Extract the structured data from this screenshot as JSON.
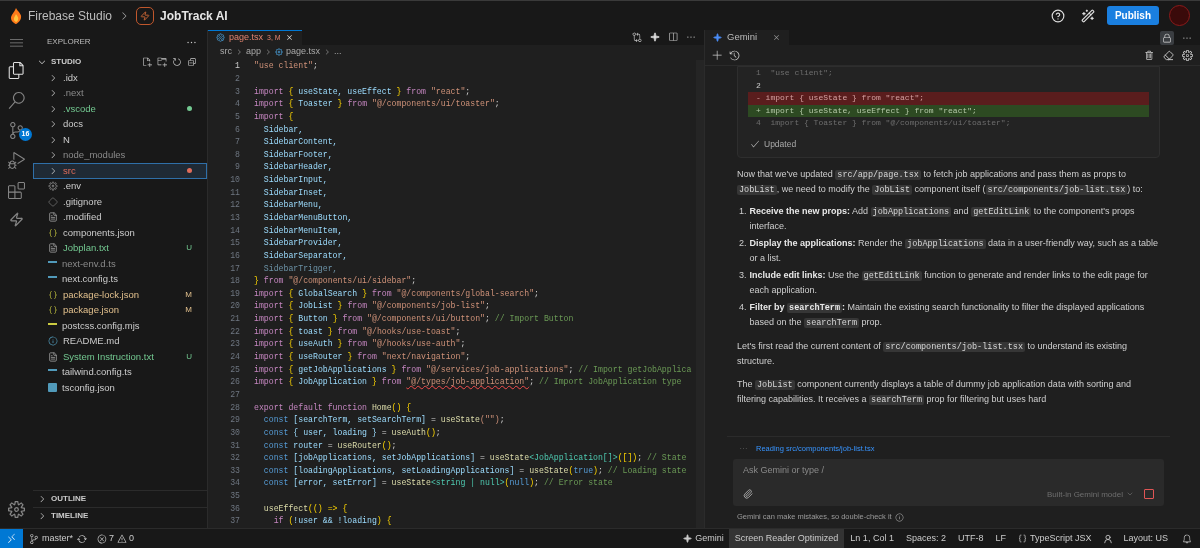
{
  "top_bar": {
    "app_name": "Firebase Studio",
    "project_name": "JobTrack AI",
    "publish_label": "Publish"
  },
  "activity_bar": {
    "source_control_badge": "16"
  },
  "explorer": {
    "title": "EXPLORER",
    "sections": [
      {
        "label": "STUDIO",
        "expanded": true,
        "children": [
          {
            "label": ".idx",
            "kind": "folder",
            "selected": false,
            "ignored": false,
            "untracked": false,
            "modified": false,
            "error": false,
            "dot": false
          },
          {
            "label": ".next",
            "kind": "folder",
            "selected": false,
            "ignored": true,
            "untracked": false,
            "modified": false,
            "error": false,
            "dot": false
          },
          {
            "label": ".vscode",
            "kind": "folder",
            "selected": false,
            "ignored": false,
            "untracked": true,
            "modified": false,
            "error": false,
            "dot": true
          },
          {
            "label": "docs",
            "kind": "folder",
            "selected": false,
            "ignored": false,
            "untracked": false,
            "modified": false,
            "error": false,
            "dot": false
          },
          {
            "label": "N",
            "kind": "folder",
            "selected": false,
            "ignored": false,
            "untracked": false,
            "modified": false,
            "error": false,
            "dot": false
          },
          {
            "label": "node_modules",
            "kind": "folder",
            "selected": false,
            "ignored": true,
            "untracked": false,
            "modified": false,
            "error": false,
            "dot": false
          },
          {
            "label": "src",
            "kind": "folder",
            "selected": true,
            "ignored": false,
            "untracked": false,
            "modified": false,
            "error": true,
            "dot": true
          },
          {
            "label": ".env",
            "kind": "gear",
            "selected": false,
            "ignored": false,
            "untracked": false,
            "modified": false,
            "error": false,
            "dot": false
          },
          {
            "label": ".gitignore",
            "kind": "diamond",
            "selected": false,
            "ignored": false,
            "untracked": false,
            "modified": false,
            "error": false,
            "dot": false
          },
          {
            "label": ".modified",
            "kind": "text",
            "selected": false,
            "ignored": false,
            "untracked": false,
            "modified": false,
            "error": false,
            "dot": false
          },
          {
            "label": "components.json",
            "kind": "json",
            "selected": false,
            "ignored": false,
            "untracked": false,
            "modified": false,
            "error": false,
            "dot": false
          },
          {
            "label": "Jobplan.txt",
            "kind": "text",
            "selected": false,
            "ignored": false,
            "untracked": true,
            "modified": false,
            "error": false,
            "dot": false,
            "status": "U"
          },
          {
            "label": "next-env.d.ts",
            "kind": "ts",
            "selected": false,
            "ignored": true,
            "untracked": false,
            "modified": false,
            "error": false,
            "dot": false
          },
          {
            "label": "next.config.ts",
            "kind": "ts",
            "selected": false,
            "ignored": false,
            "untracked": false,
            "modified": false,
            "error": false,
            "dot": false
          },
          {
            "label": "package-lock.json",
            "kind": "json",
            "selected": false,
            "ignored": false,
            "untracked": false,
            "modified": true,
            "error": false,
            "dot": false,
            "status": "M"
          },
          {
            "label": "package.json",
            "kind": "json",
            "selected": false,
            "ignored": false,
            "untracked": false,
            "modified": true,
            "error": false,
            "dot": false,
            "status": "M"
          },
          {
            "label": "postcss.config.mjs",
            "kind": "js",
            "selected": false,
            "ignored": false,
            "untracked": false,
            "modified": false,
            "error": false,
            "dot": false
          },
          {
            "label": "README.md",
            "kind": "info",
            "selected": false,
            "ignored": false,
            "untracked": false,
            "modified": false,
            "error": false,
            "dot": false
          },
          {
            "label": "System Instruction.txt",
            "kind": "text",
            "selected": false,
            "ignored": false,
            "untracked": true,
            "modified": false,
            "error": false,
            "dot": false,
            "status": "U"
          },
          {
            "label": "tailwind.config.ts",
            "kind": "ts",
            "selected": false,
            "ignored": false,
            "untracked": false,
            "modified": false,
            "error": false,
            "dot": false
          },
          {
            "label": "tsconfig.json",
            "kind": "tsconfig",
            "selected": false,
            "ignored": false,
            "untracked": false,
            "modified": false,
            "error": false,
            "dot": false
          }
        ]
      },
      {
        "label": "OUTLINE",
        "expanded": false
      },
      {
        "label": "TIMELINE",
        "expanded": false
      }
    ]
  },
  "editor": {
    "tab": {
      "label": "page.tsx",
      "badge": "3, M"
    },
    "breadcrumb": [
      "src",
      "app",
      "page.tsx",
      "..."
    ],
    "lines": [
      {
        "n": "1",
        "tokens": [
          {
            "kind": "str",
            "text": "\"use client\""
          },
          {
            "kind": "punct",
            "text": ";"
          }
        ]
      },
      {
        "n": "2"
      },
      {
        "n": "3",
        "tokens": [
          {
            "kind": "kw",
            "text": "import "
          },
          {
            "kind": "brace",
            "text": "{"
          },
          {
            "kind": "id",
            "text": " useState, useEffect "
          },
          {
            "kind": "brace",
            "text": "}"
          },
          {
            "kind": "kw",
            "text": " from "
          },
          {
            "kind": "str",
            "text": "\"react\""
          },
          {
            "kind": "punct",
            "text": ";"
          }
        ]
      },
      {
        "n": "4",
        "tokens": [
          {
            "kind": "kw",
            "text": "import "
          },
          {
            "kind": "brace",
            "text": "{"
          },
          {
            "kind": "id",
            "text": " Toaster "
          },
          {
            "kind": "brace",
            "text": "}"
          },
          {
            "kind": "kw",
            "text": " from "
          },
          {
            "kind": "str",
            "text": "\"@/components/ui/toaster\""
          },
          {
            "kind": "punct",
            "text": ";"
          }
        ]
      },
      {
        "n": "5",
        "tokens": [
          {
            "kind": "kw",
            "text": "import "
          },
          {
            "kind": "brace",
            "text": "{"
          }
        ]
      },
      {
        "n": "6",
        "tokens": [
          {
            "kind": "id",
            "text": "  Sidebar,"
          }
        ]
      },
      {
        "n": "7",
        "tokens": [
          {
            "kind": "id",
            "text": "  SidebarContent,"
          }
        ]
      },
      {
        "n": "8",
        "tokens": [
          {
            "kind": "id",
            "text": "  SidebarFooter,"
          }
        ]
      },
      {
        "n": "9",
        "tokens": [
          {
            "kind": "id",
            "text": "  SidebarHeader,"
          }
        ]
      },
      {
        "n": "10",
        "tokens": [
          {
            "kind": "id",
            "text": "  SidebarInput,"
          }
        ]
      },
      {
        "n": "11",
        "tokens": [
          {
            "kind": "id",
            "text": "  SidebarInset,"
          }
        ]
      },
      {
        "n": "12",
        "tokens": [
          {
            "kind": "id",
            "text": "  SidebarMenu,"
          }
        ]
      },
      {
        "n": "13",
        "tokens": [
          {
            "kind": "id",
            "text": "  SidebarMenuButton,"
          }
        ]
      },
      {
        "n": "14",
        "tokens": [
          {
            "kind": "id",
            "text": "  SidebarMenuItem,"
          }
        ]
      },
      {
        "n": "15",
        "tokens": [
          {
            "kind": "id",
            "text": "  SidebarProvider,"
          }
        ]
      },
      {
        "n": "16",
        "tokens": [
          {
            "kind": "id",
            "text": "  SidebarSeparator,"
          }
        ]
      },
      {
        "n": "17",
        "tokens": [
          {
            "kind": "dim",
            "text": "  SidebarTrigger,"
          }
        ]
      },
      {
        "n": "18",
        "tokens": [
          {
            "kind": "brace",
            "text": "}"
          },
          {
            "kind": "kw",
            "text": " from "
          },
          {
            "kind": "str",
            "text": "\"@/components/ui/sidebar\""
          },
          {
            "kind": "punct",
            "text": ";"
          }
        ]
      },
      {
        "n": "19",
        "tokens": [
          {
            "kind": "kw",
            "text": "import "
          },
          {
            "kind": "brace",
            "text": "{"
          },
          {
            "kind": "id",
            "text": " GlobalSearch "
          },
          {
            "kind": "brace",
            "text": "}"
          },
          {
            "kind": "kw",
            "text": " from "
          },
          {
            "kind": "str",
            "text": "\"@/components/global-search\""
          },
          {
            "kind": "punct",
            "text": ";"
          }
        ]
      },
      {
        "n": "20",
        "tokens": [
          {
            "kind": "kw",
            "text": "import "
          },
          {
            "kind": "brace",
            "text": "{"
          },
          {
            "kind": "id",
            "text": " JobList "
          },
          {
            "kind": "brace",
            "text": "}"
          },
          {
            "kind": "kw",
            "text": " from "
          },
          {
            "kind": "str",
            "text": "\"@/components/job-list\""
          },
          {
            "kind": "punct",
            "text": ";"
          }
        ]
      },
      {
        "n": "21",
        "tokens": [
          {
            "kind": "kw",
            "text": "import "
          },
          {
            "kind": "brace",
            "text": "{"
          },
          {
            "kind": "id",
            "text": " Button "
          },
          {
            "kind": "brace",
            "text": "}"
          },
          {
            "kind": "kw",
            "text": " from "
          },
          {
            "kind": "str",
            "text": "\"@/components/ui/button\""
          },
          {
            "kind": "punct",
            "text": "; "
          },
          {
            "kind": "comment",
            "text": "// Import Button"
          }
        ]
      },
      {
        "n": "22",
        "tokens": [
          {
            "kind": "kw",
            "text": "import "
          },
          {
            "kind": "brace",
            "text": "{"
          },
          {
            "kind": "id",
            "text": " toast "
          },
          {
            "kind": "brace",
            "text": "}"
          },
          {
            "kind": "kw",
            "text": " from "
          },
          {
            "kind": "str",
            "text": "\"@/hooks/use-toast\""
          },
          {
            "kind": "punct",
            "text": ";"
          }
        ]
      },
      {
        "n": "23",
        "tokens": [
          {
            "kind": "kw",
            "text": "import "
          },
          {
            "kind": "brace",
            "text": "{"
          },
          {
            "kind": "id",
            "text": " useAuth "
          },
          {
            "kind": "brace",
            "text": "}"
          },
          {
            "kind": "kw",
            "text": " from "
          },
          {
            "kind": "str",
            "text": "\"@/hooks/use-auth\""
          },
          {
            "kind": "punct",
            "text": ";"
          }
        ]
      },
      {
        "n": "24",
        "tokens": [
          {
            "kind": "kw",
            "text": "import "
          },
          {
            "kind": "brace",
            "text": "{"
          },
          {
            "kind": "id",
            "text": " useRouter "
          },
          {
            "kind": "brace",
            "text": "}"
          },
          {
            "kind": "kw",
            "text": " from "
          },
          {
            "kind": "str",
            "text": "\"next/navigation\""
          },
          {
            "kind": "punct",
            "text": ";"
          }
        ]
      },
      {
        "n": "25",
        "tokens": [
          {
            "kind": "kw",
            "text": "import "
          },
          {
            "kind": "brace",
            "text": "{"
          },
          {
            "kind": "id",
            "text": " getJobApplications "
          },
          {
            "kind": "brace",
            "text": "}"
          },
          {
            "kind": "kw",
            "text": " from "
          },
          {
            "kind": "str",
            "text": "\"@/services/job-applications\""
          },
          {
            "kind": "punct",
            "text": "; "
          },
          {
            "kind": "comment",
            "text": "// Import getJobApplica"
          }
        ]
      },
      {
        "n": "26",
        "tokens": [
          {
            "kind": "kw",
            "text": "import "
          },
          {
            "kind": "brace",
            "text": "{"
          },
          {
            "kind": "id",
            "text": " JobApplication "
          },
          {
            "kind": "brace",
            "text": "}"
          },
          {
            "kind": "kw",
            "text": " from "
          },
          {
            "kind": "err",
            "text": "\"@/types/job-application\""
          },
          {
            "kind": "punct",
            "text": "; "
          },
          {
            "kind": "comment",
            "text": "// Import JobApplication type"
          }
        ]
      },
      {
        "n": "27"
      },
      {
        "n": "28",
        "tokens": [
          {
            "kind": "kw",
            "text": "export default function "
          },
          {
            "kind": "fn",
            "text": "Home"
          },
          {
            "kind": "brace",
            "text": "() {"
          }
        ]
      },
      {
        "n": "29",
        "tokens": [
          {
            "kind": "decl",
            "text": "  const "
          },
          {
            "kind": "id",
            "text": "[searchTerm, setSearchTerm] "
          },
          {
            "kind": "punct",
            "text": "= "
          },
          {
            "kind": "fn",
            "text": "useState"
          },
          {
            "kind": "str",
            "text": "(\"\")"
          },
          {
            "kind": "punct",
            "text": ";"
          }
        ]
      },
      {
        "n": "30",
        "tokens": [
          {
            "kind": "decl",
            "text": "  const "
          },
          {
            "kind": "id",
            "text": "{ user, loading } "
          },
          {
            "kind": "punct",
            "text": "= "
          },
          {
            "kind": "fn",
            "text": "useAuth"
          },
          {
            "kind": "brace",
            "text": "()"
          },
          {
            "kind": "punct",
            "text": ";"
          }
        ]
      },
      {
        "n": "31",
        "tokens": [
          {
            "kind": "decl",
            "text": "  const "
          },
          {
            "kind": "id",
            "text": "router "
          },
          {
            "kind": "punct",
            "text": "= "
          },
          {
            "kind": "fn",
            "text": "useRouter"
          },
          {
            "kind": "brace",
            "text": "()"
          },
          {
            "kind": "punct",
            "text": ";"
          }
        ]
      },
      {
        "n": "32",
        "tokens": [
          {
            "kind": "decl",
            "text": "  const "
          },
          {
            "kind": "id",
            "text": "[jobApplications, setJobApplications] "
          },
          {
            "kind": "punct",
            "text": "= "
          },
          {
            "kind": "fn",
            "text": "useState"
          },
          {
            "kind": "type",
            "text": "<JobApplication[]>"
          },
          {
            "kind": "brace",
            "text": "([])"
          },
          {
            "kind": "punct",
            "text": "; "
          },
          {
            "kind": "comment",
            "text": "// State"
          }
        ]
      },
      {
        "n": "33",
        "tokens": [
          {
            "kind": "decl",
            "text": "  const "
          },
          {
            "kind": "id",
            "text": "[loadingApplications, setLoadingApplications] "
          },
          {
            "kind": "punct",
            "text": "= "
          },
          {
            "kind": "fn",
            "text": "useState"
          },
          {
            "kind": "brace",
            "text": "("
          },
          {
            "kind": "decl",
            "text": "true"
          },
          {
            "kind": "brace",
            "text": ")"
          },
          {
            "kind": "punct",
            "text": "; "
          },
          {
            "kind": "comment",
            "text": "// Loading state"
          }
        ]
      },
      {
        "n": "34",
        "tokens": [
          {
            "kind": "decl",
            "text": "  const "
          },
          {
            "kind": "id",
            "text": "[error, setError] "
          },
          {
            "kind": "punct",
            "text": "= "
          },
          {
            "kind": "fn",
            "text": "useState"
          },
          {
            "kind": "type",
            "text": "<string | null>"
          },
          {
            "kind": "brace",
            "text": "("
          },
          {
            "kind": "decl",
            "text": "null"
          },
          {
            "kind": "brace",
            "text": ")"
          },
          {
            "kind": "punct",
            "text": "; "
          },
          {
            "kind": "comment",
            "text": "// Error state"
          }
        ]
      },
      {
        "n": "35"
      },
      {
        "n": "36",
        "tokens": [
          {
            "kind": "fn",
            "text": "  useEffect"
          },
          {
            "kind": "brace",
            "text": "(() => {"
          }
        ]
      },
      {
        "n": "37",
        "tokens": [
          {
            "kind": "kw",
            "text": "    if "
          },
          {
            "kind": "brace",
            "text": "("
          },
          {
            "kind": "id",
            "text": "!user && !loading"
          },
          {
            "kind": "brace",
            "text": ") {"
          }
        ]
      }
    ]
  },
  "gemini": {
    "tab_label": "Gemini",
    "diff": {
      "lines": [
        {
          "kind": "faded",
          "text": "1  \"use client\";"
        },
        {
          "kind": "context",
          "text": "2"
        },
        {
          "kind": "removed",
          "text": "- import { useState } from \"react\";"
        },
        {
          "kind": "added",
          "text": "+ import { useState, useEffect } from \"react\";"
        },
        {
          "kind": "faded",
          "text": "4  import { Toaster } from \"@/components/ui/toaster\";"
        }
      ],
      "status": "Updated"
    },
    "blocks": [
      {
        "kind": "paragraph",
        "segments": [
          {
            "kind": "text",
            "text": "Now that we've updated "
          },
          {
            "kind": "code",
            "text": "src/app/page.tsx"
          },
          {
            "kind": "text",
            "text": " to fetch job applications and pass them as props to "
          },
          {
            "kind": "code",
            "text": "JobList"
          },
          {
            "kind": "text",
            "text": ", we need to modify the "
          },
          {
            "kind": "code",
            "text": "JobList"
          },
          {
            "kind": "text",
            "text": " component itself ("
          },
          {
            "kind": "code",
            "text": "src/components/job-list.tsx"
          },
          {
            "kind": "text",
            "text": ") to:"
          }
        ]
      },
      {
        "kind": "list",
        "items": [
          {
            "number": "1.",
            "segments": [
              {
                "kind": "bold",
                "text": "Receive the new props:"
              },
              {
                "kind": "text",
                "text": " Add "
              },
              {
                "kind": "code",
                "text": "jobApplications"
              },
              {
                "kind": "text",
                "text": " and "
              },
              {
                "kind": "code",
                "text": "getEditLink"
              },
              {
                "kind": "text",
                "text": " to the component's props interface."
              }
            ]
          },
          {
            "number": "2.",
            "segments": [
              {
                "kind": "bold",
                "text": "Display the applications:"
              },
              {
                "kind": "text",
                "text": " Render the "
              },
              {
                "kind": "code",
                "text": "jobApplications"
              },
              {
                "kind": "text",
                "text": " data in a user-friendly way, such as a table or a list."
              }
            ]
          },
          {
            "number": "3.",
            "segments": [
              {
                "kind": "bold",
                "text": "Include edit links:"
              },
              {
                "kind": "text",
                "text": " Use the "
              },
              {
                "kind": "code",
                "text": "getEditLink"
              },
              {
                "kind": "text",
                "text": " function to generate and render links to the edit page for each application."
              }
            ]
          },
          {
            "number": "4.",
            "segments": [
              {
                "kind": "bold",
                "text": "Filter by "
              },
              {
                "kind": "boldcode",
                "text": "searchTerm"
              },
              {
                "kind": "bold",
                "text": ":"
              },
              {
                "kind": "text",
                "text": " Maintain the existing search functionality to filter the displayed applications based on the "
              },
              {
                "kind": "code",
                "text": "searchTerm"
              },
              {
                "kind": "text",
                "text": " prop."
              }
            ]
          }
        ]
      },
      {
        "kind": "paragraph",
        "segments": [
          {
            "kind": "text",
            "text": "Let's first read the current content of "
          },
          {
            "kind": "code",
            "text": "src/components/job-list.tsx"
          },
          {
            "kind": "text",
            "text": " to understand its existing structure."
          }
        ]
      },
      {
        "kind": "paragraph",
        "segments": [
          {
            "kind": "text",
            "text": "The "
          },
          {
            "kind": "code",
            "text": "JobList"
          },
          {
            "kind": "text",
            "text": " component currently displays a table of dummy job application data with sorting and filtering capabilities. It receives a "
          },
          {
            "kind": "code",
            "text": "searchTerm"
          },
          {
            "kind": "text",
            "text": " prop for filtering but uses hard"
          }
        ]
      }
    ],
    "activity": "Reading src/components/job-list.tsx",
    "composer": {
      "placeholder": "Ask Gemini or type /",
      "model": "Built-in Gemini model"
    },
    "disclaimer": "Gemini can make mistakes, so double-check it"
  },
  "status_bar": {
    "branch": "master*",
    "errors": "7",
    "warnings": "0",
    "right": [
      {
        "kind": "gemini",
        "text": "Gemini"
      },
      {
        "kind": "highlight",
        "text": "Screen Reader Optimized"
      },
      {
        "kind": "plain",
        "text": "Ln 1, Col 1"
      },
      {
        "kind": "plain",
        "text": "Spaces: 2"
      },
      {
        "kind": "plain",
        "text": "UTF-8"
      },
      {
        "kind": "plain",
        "text": "LF"
      },
      {
        "kind": "braces",
        "text": "TypeScript JSX"
      },
      {
        "kind": "person",
        "text": "Layout: US"
      }
    ]
  }
}
